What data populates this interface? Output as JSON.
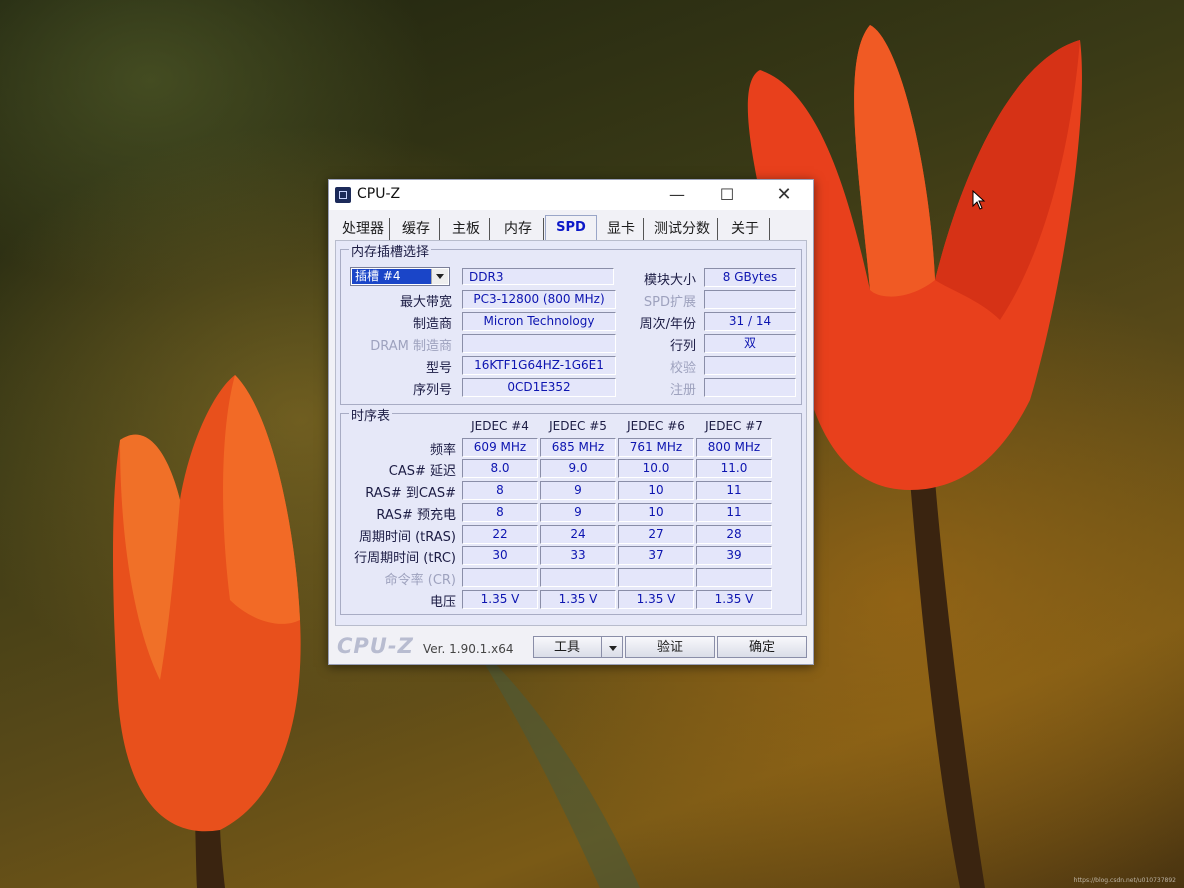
{
  "window": {
    "title": "CPU-Z",
    "min_glyph": "—",
    "max_glyph": "☐",
    "close_glyph": "✕"
  },
  "tabs": [
    "处理器",
    "缓存",
    "主板",
    "内存",
    "SPD",
    "显卡",
    "测试分数",
    "关于"
  ],
  "active_tab": "SPD",
  "slot_group": {
    "title": "内存插槽选择",
    "slot_select": "插槽 #4",
    "memory_type": "DDR3",
    "fields_left": [
      {
        "label": "最大带宽",
        "value": "PC3-12800 (800 MHz)",
        "dim": false
      },
      {
        "label": "制造商",
        "value": "Micron Technology",
        "dim": false
      },
      {
        "label": "DRAM 制造商",
        "value": "",
        "dim": true
      },
      {
        "label": "型号",
        "value": "16KTF1G64HZ-1G6E1",
        "dim": false
      },
      {
        "label": "序列号",
        "value": "0CD1E352",
        "dim": false
      }
    ],
    "fields_right": [
      {
        "label": "模块大小",
        "value": "8 GBytes",
        "dim": false
      },
      {
        "label": "SPD扩展",
        "value": "",
        "dim": true
      },
      {
        "label": "周次/年份",
        "value": "31 / 14",
        "dim": false
      },
      {
        "label": "行列",
        "value": "双",
        "dim": false
      },
      {
        "label": "校验",
        "value": "",
        "dim": true
      },
      {
        "label": "注册",
        "value": "",
        "dim": true
      }
    ]
  },
  "timing_group": {
    "title": "时序表",
    "columns": [
      "JEDEC #4",
      "JEDEC #5",
      "JEDEC #6",
      "JEDEC #7"
    ],
    "rows": [
      {
        "label": "频率",
        "dim": false,
        "values": [
          "609 MHz",
          "685 MHz",
          "761 MHz",
          "800 MHz"
        ]
      },
      {
        "label": "CAS# 延迟",
        "dim": false,
        "values": [
          "8.0",
          "9.0",
          "10.0",
          "11.0"
        ]
      },
      {
        "label": "RAS# 到CAS#",
        "dim": false,
        "values": [
          "8",
          "9",
          "10",
          "11"
        ]
      },
      {
        "label": "RAS# 预充电",
        "dim": false,
        "values": [
          "8",
          "9",
          "10",
          "11"
        ]
      },
      {
        "label": "周期时间 (tRAS)",
        "dim": false,
        "values": [
          "22",
          "24",
          "27",
          "28"
        ]
      },
      {
        "label": "行周期时间 (tRC)",
        "dim": false,
        "values": [
          "30",
          "33",
          "37",
          "39"
        ]
      },
      {
        "label": "命令率 (CR)",
        "dim": true,
        "values": [
          "",
          "",
          "",
          ""
        ]
      },
      {
        "label": "电压",
        "dim": false,
        "values": [
          "1.35 V",
          "1.35 V",
          "1.35 V",
          "1.35 V"
        ]
      }
    ]
  },
  "footer": {
    "logo": "CPU-Z",
    "version": "Ver. 1.90.1.x64",
    "tools_label": "工具",
    "validate_label": "验证",
    "ok_label": "确定"
  },
  "watermark": "https://blog.csdn.net/u010737892"
}
